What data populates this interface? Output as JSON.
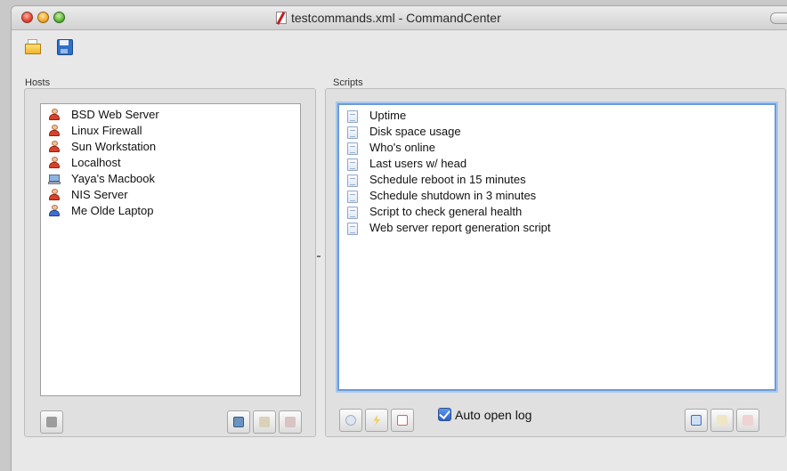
{
  "window": {
    "title": "testcommands.xml - CommandCenter"
  },
  "toolbar": {
    "open_icon": "open-document-icon",
    "save_icon": "save-icon"
  },
  "hosts": {
    "label": "Hosts",
    "items": [
      {
        "name": "BSD Web Server",
        "icon": "person-icon"
      },
      {
        "name": "Linux Firewall",
        "icon": "person-icon"
      },
      {
        "name": "Sun Workstation",
        "icon": "person-icon"
      },
      {
        "name": "Localhost",
        "icon": "person-icon"
      },
      {
        "name": "Yaya's Macbook",
        "icon": "laptop-icon"
      },
      {
        "name": "NIS Server",
        "icon": "person-icon"
      },
      {
        "name": "Me Olde Laptop",
        "icon": "person-icon",
        "color": "#3d6fd1"
      }
    ]
  },
  "scripts": {
    "label": "Scripts",
    "items": [
      "Uptime",
      "Disk space usage",
      "Who's online",
      "Last users w/ head",
      "Schedule reboot in 15 minutes",
      "Schedule shutdown in 3 minutes",
      "Script to check general health",
      "Web server report generation script"
    ],
    "auto_open_log_label": "Auto open log",
    "auto_open_log_checked": true
  },
  "colors": {
    "focus_ring": "#6d9bd8",
    "checkbox": "#2a62c8"
  }
}
